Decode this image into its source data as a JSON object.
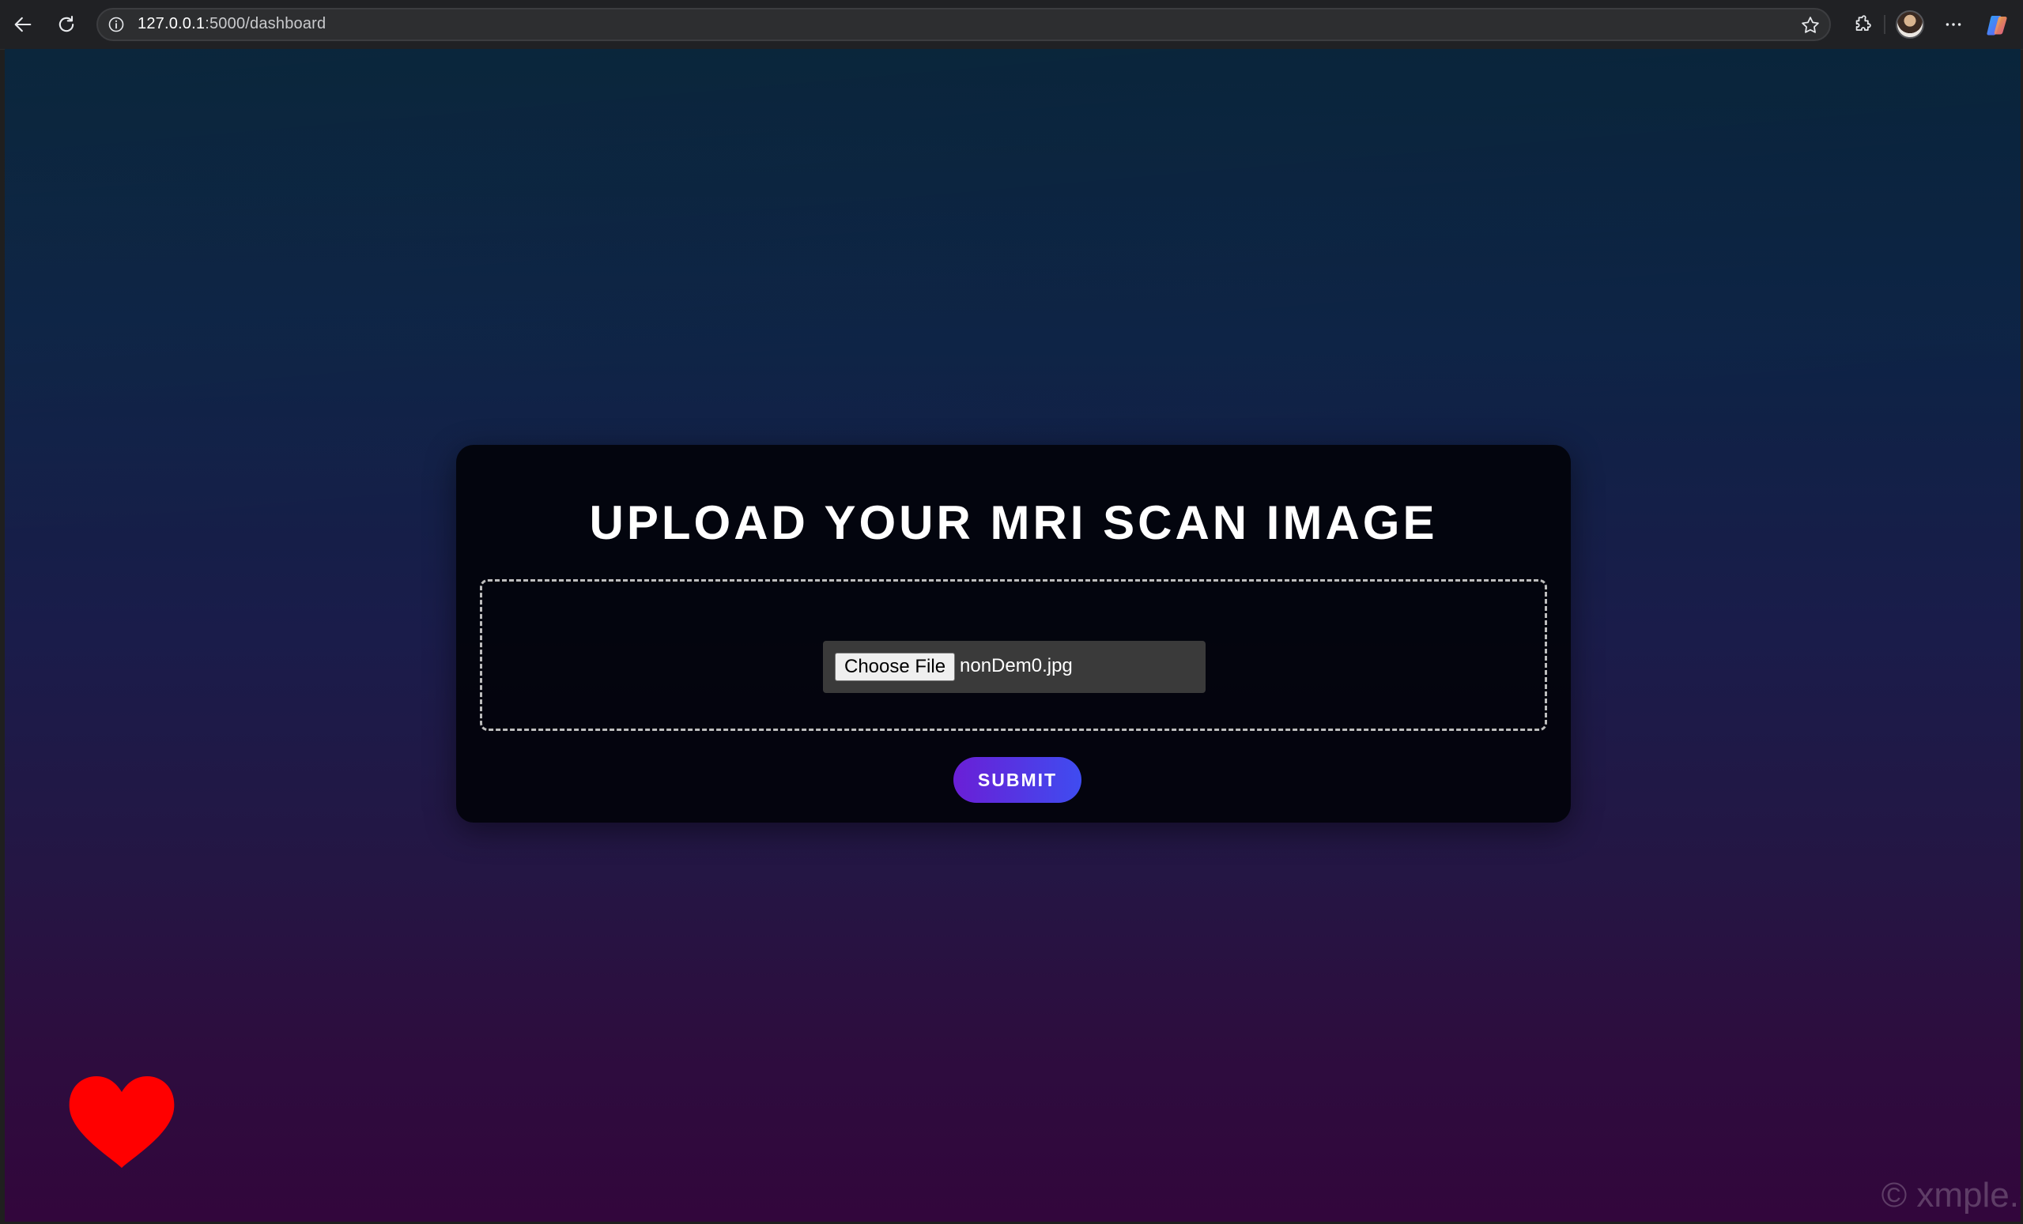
{
  "browser": {
    "url_host": "127.0.0.1",
    "url_rest": ":5000/dashboard",
    "icons": {
      "back": "back-arrow-icon",
      "reload": "reload-icon",
      "info": "info-icon",
      "favorite": "star-icon",
      "extensions": "extensions-icon",
      "profile": "avatar",
      "menu": "more-menu-icon",
      "copilot": "copilot-icon"
    }
  },
  "page": {
    "title": "UPLOAD YOUR MRI SCAN IMAGE",
    "file_input": {
      "button_label": "Choose File",
      "file_name": "nonDem0.jpg"
    },
    "submit_label": "SUBMIT",
    "heart_icon": "heart-icon",
    "heart_color": "#ff0000",
    "accent_gradient": [
      "#6a1fd6",
      "#3f4cf0"
    ]
  },
  "watermark": {
    "text": "© xmple.c"
  }
}
